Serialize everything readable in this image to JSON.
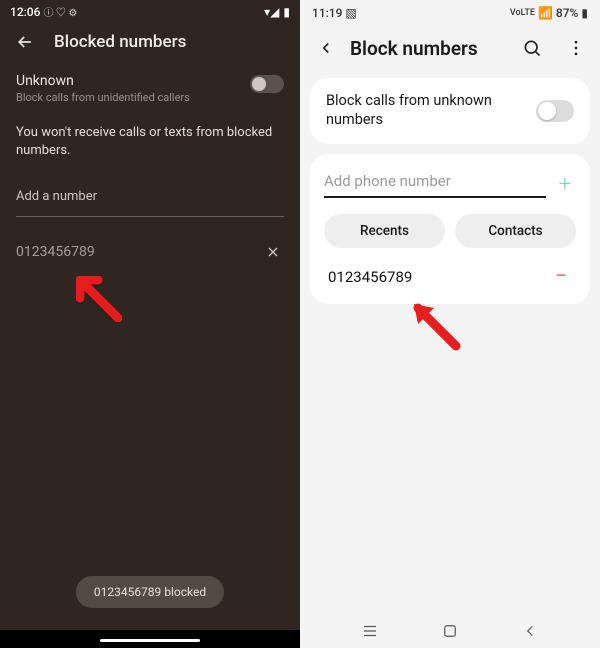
{
  "left": {
    "status": {
      "time": "12:06",
      "icons": "ⓘ ♡ ⚙"
    },
    "header": {
      "title": "Blocked numbers"
    },
    "unknown": {
      "title": "Unknown",
      "subtitle": "Block calls from unidentified callers"
    },
    "hint": "You won't receive calls or texts from blocked numbers.",
    "add_label": "Add a number",
    "entry": "0123456789",
    "toast": "0123456789 blocked"
  },
  "right": {
    "status": {
      "time": "11:19",
      "battery": "87%"
    },
    "header": {
      "title": "Block numbers"
    },
    "unknown_label": "Block calls from unknown numbers",
    "input_placeholder": "Add phone number",
    "recents_label": "Recents",
    "contacts_label": "Contacts",
    "entry": "0123456789"
  }
}
